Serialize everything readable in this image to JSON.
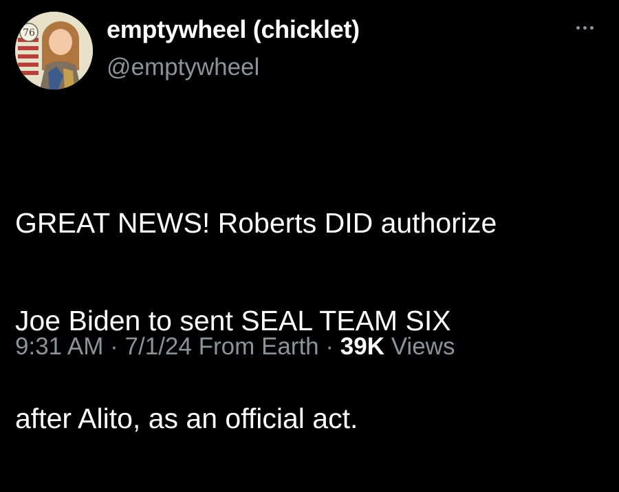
{
  "tweet": {
    "display_name": "emptywheel (chicklet)",
    "handle": "@emptywheel",
    "more_icon": "more-horizontal-icon",
    "avatar_badge": "76",
    "text_lines": [
      "GREAT NEWS! Roberts DID authorize",
      "Joe Biden to sent SEAL TEAM SIX",
      "after Alito, as an official act."
    ],
    "time": "9:31 AM",
    "separator": "·",
    "date": "7/1/24",
    "source": "From Earth",
    "views_count": "39K",
    "views_label": "Views"
  },
  "colors": {
    "background": "#000000",
    "primary_text": "#ffffff",
    "secondary_text": "#8b949a"
  }
}
